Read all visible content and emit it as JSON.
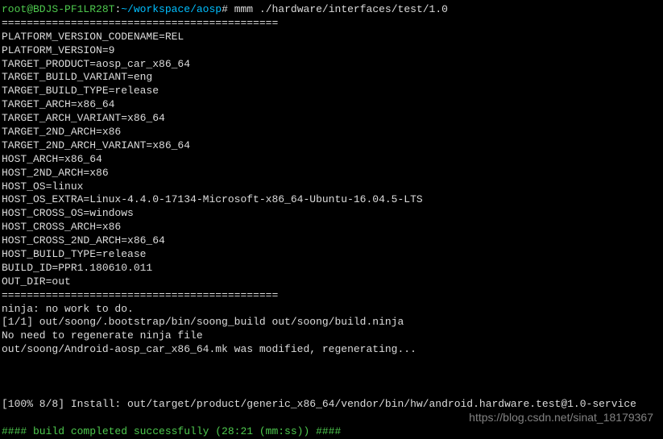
{
  "prompt": {
    "user_host": "root@BDJS-PF1LR28T",
    "separator1": ":",
    "path": "~/workspace/aosp",
    "separator2": "#",
    "command": "mmm ./hardware/interfaces/test/1.0"
  },
  "separator_line": "============================================",
  "build_vars": [
    "PLATFORM_VERSION_CODENAME=REL",
    "PLATFORM_VERSION=9",
    "TARGET_PRODUCT=aosp_car_x86_64",
    "TARGET_BUILD_VARIANT=eng",
    "TARGET_BUILD_TYPE=release",
    "TARGET_ARCH=x86_64",
    "TARGET_ARCH_VARIANT=x86_64",
    "TARGET_2ND_ARCH=x86",
    "TARGET_2ND_ARCH_VARIANT=x86_64",
    "HOST_ARCH=x86_64",
    "HOST_2ND_ARCH=x86",
    "HOST_OS=linux",
    "HOST_OS_EXTRA=Linux-4.4.0-17134-Microsoft-x86_64-Ubuntu-16.04.5-LTS",
    "HOST_CROSS_OS=windows",
    "HOST_CROSS_ARCH=x86",
    "HOST_CROSS_2ND_ARCH=x86_64",
    "HOST_BUILD_TYPE=release",
    "BUILD_ID=PPR1.180610.011",
    "OUT_DIR=out"
  ],
  "ninja_lines": [
    "ninja: no work to do.",
    "[1/1] out/soong/.bootstrap/bin/soong_build out/soong/build.ninja",
    "No need to regenerate ninja file",
    "out/soong/Android-aosp_car_x86_64.mk was modified, regenerating..."
  ],
  "install_line": "[100% 8/8] Install: out/target/product/generic_x86_64/vendor/bin/hw/android.hardware.test@1.0-service",
  "success_line": "#### build completed successfully (28:21 (mm:ss)) ####",
  "watermark": "https://blog.csdn.net/sinat_18179367"
}
